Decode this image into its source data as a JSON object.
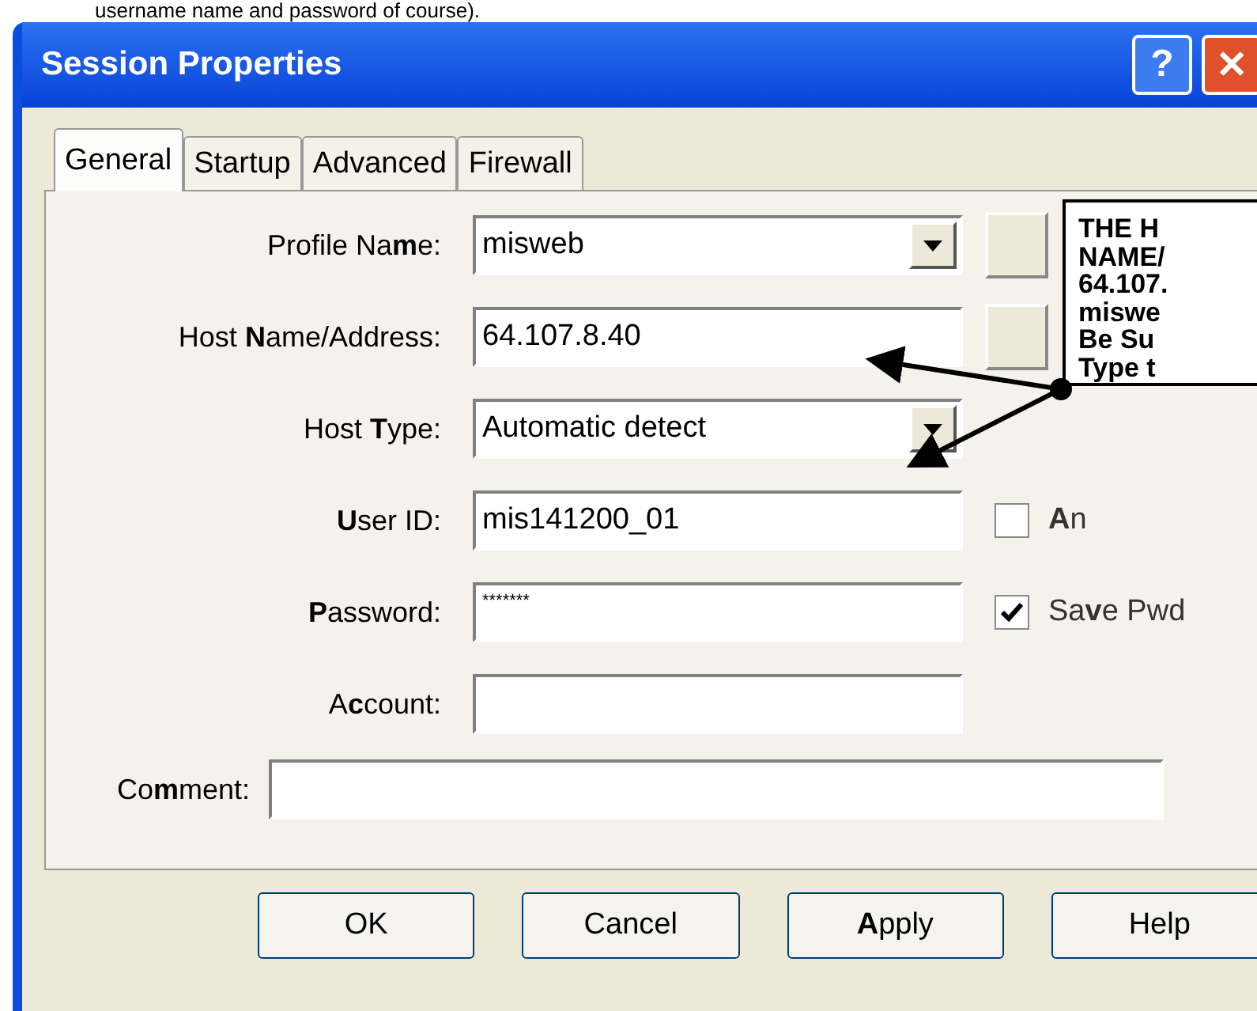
{
  "caption": "username name and password of course).",
  "window": {
    "title": "Session Properties",
    "help": "?",
    "close": "✕"
  },
  "tabs": [
    {
      "label": "General",
      "selected": true
    },
    {
      "label": "Startup",
      "selected": false
    },
    {
      "label": "Advanced",
      "selected": false
    },
    {
      "label": "Firewall",
      "selected": false
    }
  ],
  "fields": [
    {
      "label": "Profile Na**m**e:",
      "value": "misweb",
      "kind": "combo"
    },
    {
      "label": "Host **N**ame/Address:",
      "value": "64.107.8.40",
      "kind": "text"
    },
    {
      "label": "Host **T**ype:",
      "value": "Automatic detect",
      "kind": "combo"
    },
    {
      "label": "**U**ser ID:",
      "value": "mis141200_01",
      "kind": "text"
    },
    {
      "label": "**P**assword:",
      "value": "*******",
      "kind": "password"
    },
    {
      "label": "A**c**count:",
      "kind": "text"
    }
  ],
  "checkboxes": [
    {
      "label": "**A**n",
      "checked": false
    },
    {
      "label": "Sa**v**e Pwd",
      "checked": true
    }
  ],
  "comment": {
    "label": "Co**m**ment:"
  },
  "buttons": [
    "OK",
    "Cancel",
    "**A**pply",
    "Help"
  ],
  "callout": {
    "lines": [
      "THE H",
      "NAME/",
      "64.107.",
      "miswe",
      "Be Su",
      "Type t"
    ]
  }
}
